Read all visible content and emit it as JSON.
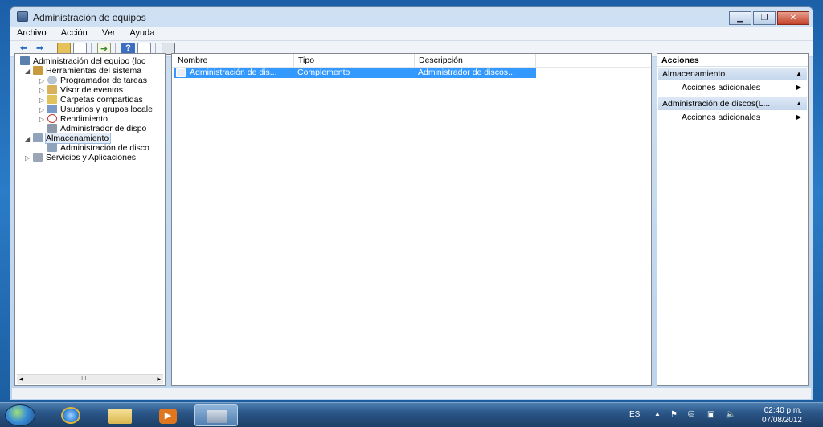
{
  "window": {
    "title": "Administración de equipos",
    "controls": {
      "minimize": "▁",
      "maximize": "❐",
      "close": "✕"
    }
  },
  "menu": [
    "Archivo",
    "Acción",
    "Ver",
    "Ayuda"
  ],
  "toolbar": {
    "icons": [
      "back-arrow-icon",
      "forward-arrow-icon",
      "up-folder-icon",
      "show-hide-tree-icon",
      "export-list-icon",
      "help-icon",
      "show-hide-actions-icon",
      "properties-icon"
    ]
  },
  "tree": {
    "items": [
      {
        "label": "Administración del equipo (loc",
        "icon": "computer-management-icon",
        "arrow": ""
      },
      {
        "label": "Herramientas del sistema",
        "icon": "system-tools-icon",
        "arrow": "◢"
      },
      {
        "label": "Programador de tareas",
        "icon": "task-scheduler-icon",
        "arrow": "▷"
      },
      {
        "label": "Visor de eventos",
        "icon": "event-viewer-icon",
        "arrow": "▷"
      },
      {
        "label": "Carpetas compartidas",
        "icon": "shared-folders-icon",
        "arrow": "▷"
      },
      {
        "label": "Usuarios y grupos locale",
        "icon": "users-groups-icon",
        "arrow": "▷"
      },
      {
        "label": "Rendimiento",
        "icon": "performance-icon",
        "arrow": "▷"
      },
      {
        "label": "Administrador de dispo",
        "icon": "device-manager-icon",
        "arrow": ""
      },
      {
        "label": "Almacenamiento",
        "icon": "storage-icon",
        "arrow": "◢"
      },
      {
        "label": "Administración de disco",
        "icon": "disk-management-icon",
        "arrow": ""
      },
      {
        "label": "Servicios y Aplicaciones",
        "icon": "services-apps-icon",
        "arrow": "▷"
      }
    ],
    "scroll": {
      "left": "◂",
      "thumb": "III",
      "right": "▸"
    }
  },
  "list": {
    "columns": [
      "Nombre",
      "Tipo",
      "Descripción"
    ],
    "rows": [
      {
        "name": "Administración de dis...",
        "type": "Complemento",
        "description": "Administrador de discos..."
      }
    ]
  },
  "actions": {
    "title": "Acciones",
    "groups": [
      {
        "header": "Almacenamiento",
        "item": "Acciones adicionales"
      },
      {
        "header": "Administración de discos(L...",
        "item": "Acciones adicionales"
      }
    ],
    "collapse_glyph": "▲",
    "more_glyph": "▶"
  },
  "taskbar": {
    "language": "ES",
    "time": "02:40 p.m.",
    "date": "07/08/2012",
    "tray_up": "▲"
  }
}
